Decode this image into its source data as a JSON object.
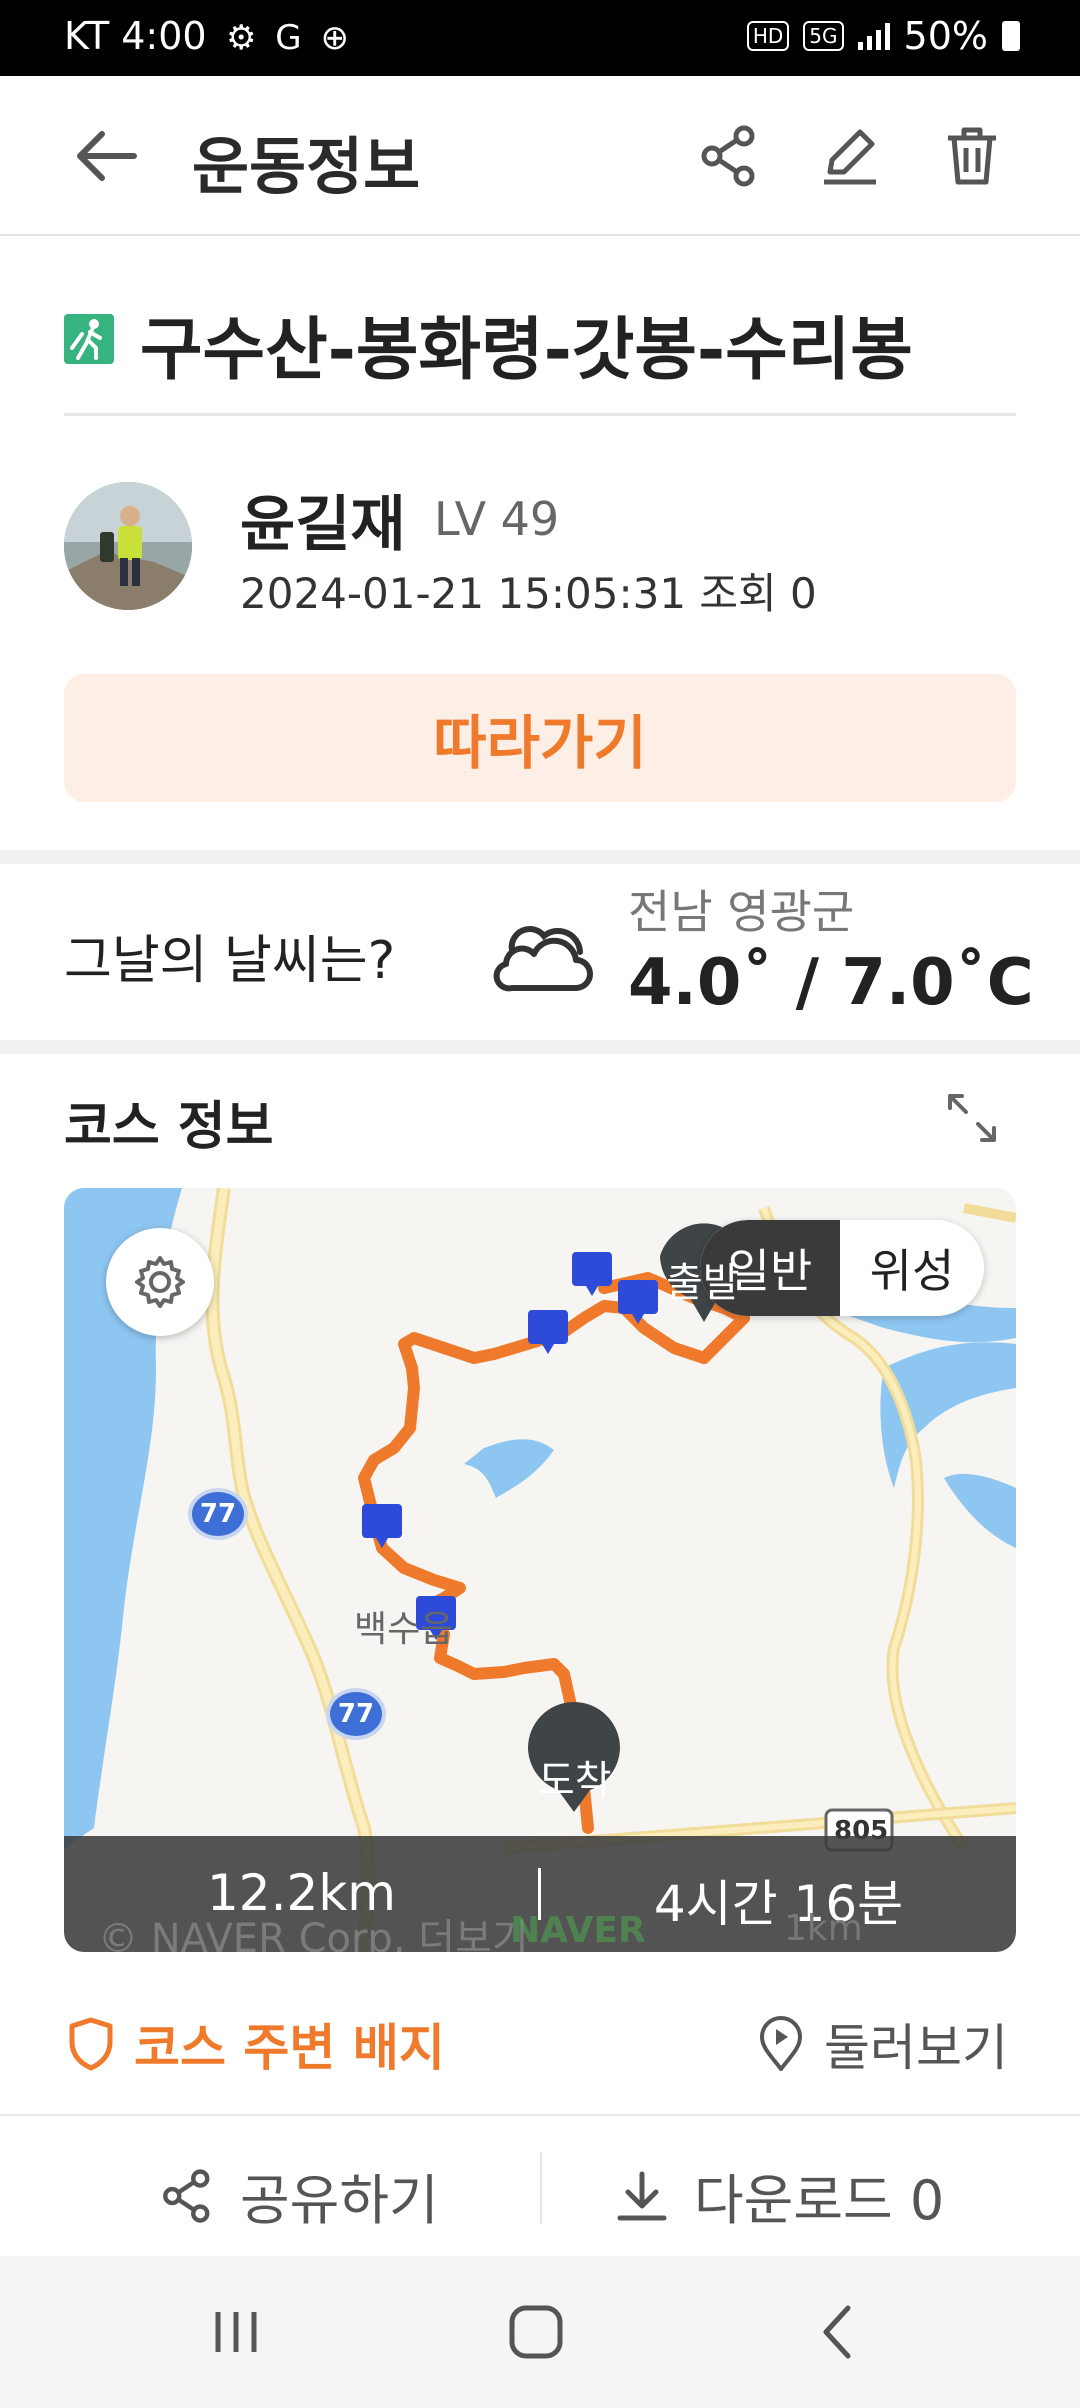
{
  "status_bar": {
    "carrier_time": "KT 4:00",
    "left_icons": "⚙ G ⊕",
    "hd_badge": "HD",
    "net_badge": "5G",
    "battery": "50%"
  },
  "app_bar": {
    "title": "운동정보",
    "back_icon": "arrow-left-icon",
    "actions": [
      "share-icon",
      "edit-icon",
      "trash-icon"
    ]
  },
  "course": {
    "title": "구수산-봉화령-갓봉-수리봉",
    "type_icon": "hiking-icon"
  },
  "user": {
    "name": "윤길재",
    "level": "LV 49",
    "meta": "2024-01-21 15:05:31 조회 0"
  },
  "follow_button": "따라가기",
  "weather": {
    "question": "그날의 날씨는?",
    "location": "전남 영광군",
    "temperature": "4.0˚ / 7.0˚C",
    "icon": "cloud-icon"
  },
  "course_info": {
    "title": "코스 정보",
    "map": {
      "toggle_normal": "일반",
      "toggle_satellite": "위성",
      "start_label": "출발",
      "end_label": "도착",
      "place_label": "백수읍",
      "road_77a": "77",
      "road_77b": "77",
      "road_805": "805",
      "credit": "© NAVER Corp. 더보기",
      "naver": "NAVER",
      "scale": "1km"
    },
    "stats": {
      "distance": "12.2km",
      "duration": "4시간 16분"
    }
  },
  "badges_link": "코스 주변 배지",
  "look_around": "둘러보기",
  "bottom_actions": {
    "share": "공유하기",
    "download": "다운로드 0"
  },
  "colors": {
    "accent": "#f07a2c",
    "follow_bg": "#fdeee6",
    "route": "#f07a2c",
    "waypoint": "#2d4bd8"
  }
}
